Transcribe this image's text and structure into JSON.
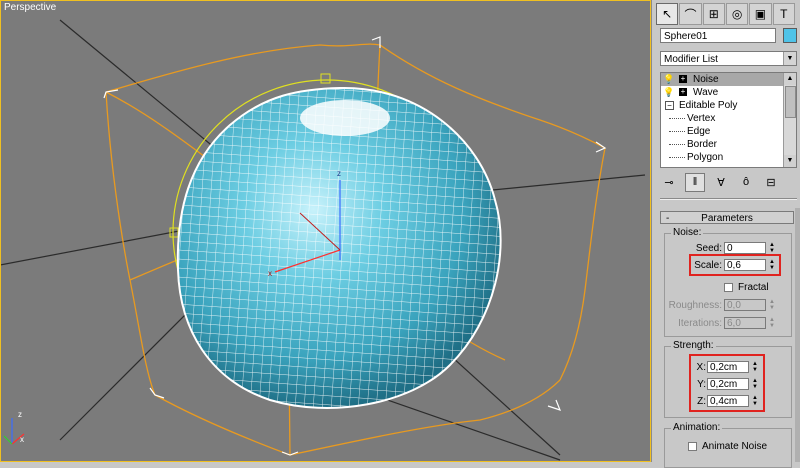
{
  "viewport": {
    "label": "Perspective",
    "gizmo_z": "z",
    "gizmo_x": "x",
    "scene_axis_z": "z",
    "scene_axis_x": "x"
  },
  "panel": {
    "tabs": [
      {
        "icon": "cursor-icon",
        "glyph": "↖",
        "active": true
      },
      {
        "icon": "curve-icon",
        "glyph": "⌒",
        "active": false
      },
      {
        "icon": "hierarchy-icon",
        "glyph": "⊞",
        "active": false
      },
      {
        "icon": "motion-icon",
        "glyph": "◎",
        "active": false
      },
      {
        "icon": "display-icon",
        "glyph": "▣",
        "active": false
      },
      {
        "icon": "utilities-icon",
        "glyph": "T",
        "active": false
      }
    ],
    "object_name": "Sphere01",
    "object_color": "#4fc3e8",
    "modifier_list": "Modifier List",
    "stack": {
      "modifiers": [
        {
          "label": "Noise",
          "selected": true
        },
        {
          "label": "Wave",
          "selected": false
        }
      ],
      "base": "Editable Poly",
      "sub_objects": [
        "Vertex",
        "Edge",
        "Border",
        "Polygon"
      ]
    },
    "stack_tools": [
      {
        "icon": "pin-stack-icon",
        "glyph": "⊸"
      },
      {
        "icon": "show-end-result-icon",
        "glyph": "‖"
      },
      {
        "icon": "make-unique-icon",
        "glyph": "∀"
      },
      {
        "icon": "remove-modifier-icon",
        "glyph": "ô"
      },
      {
        "icon": "configure-sets-icon",
        "glyph": "⊟"
      }
    ]
  },
  "parameters": {
    "rollout_title": "Parameters",
    "rollout_toggle": "-",
    "noise": {
      "title": "Noise:",
      "seed_label": "Seed:",
      "seed": "0",
      "scale_label": "Scale:",
      "scale": "0,6",
      "fractal_label": "Fractal",
      "roughness_label": "Roughness:",
      "roughness": "0,0",
      "iterations_label": "Iterations:",
      "iterations": "6,0"
    },
    "strength": {
      "title": "Strength:",
      "x_label": "X:",
      "x": "0,2cm",
      "y_label": "Y:",
      "y": "0,2cm",
      "z_label": "Z:",
      "z": "0,4cm"
    },
    "animation": {
      "title": "Animation:",
      "animate_label": "Animate Noise"
    }
  },
  "colors": {
    "viewport_bg": "#7b7b7b",
    "sphere_fill": "#4ab3cc",
    "highlight": "#e0231f",
    "gizmo_orange": "#e89a20",
    "selection_yellow": "#e0e020"
  }
}
